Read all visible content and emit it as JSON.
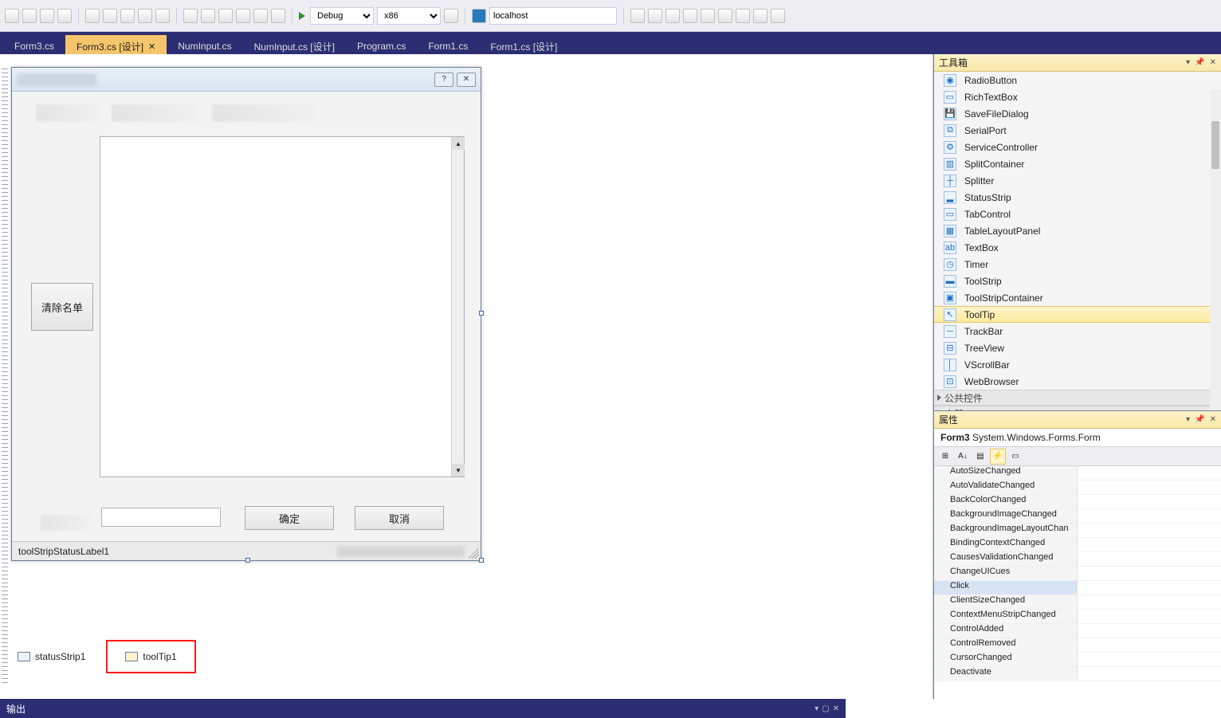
{
  "toolbar": {
    "config": "Debug",
    "platform": "x86",
    "target": "localhost"
  },
  "tabs": [
    {
      "label": "Form3.cs"
    },
    {
      "label": "Form3.cs [设计]",
      "active": true
    },
    {
      "label": "NumInput.cs"
    },
    {
      "label": "NumInput.cs [设计]"
    },
    {
      "label": "Program.cs"
    },
    {
      "label": "Form1.cs"
    },
    {
      "label": "Form1.cs [设计]"
    }
  ],
  "designer": {
    "clearButton": "清除名单",
    "okButton": "确定",
    "cancelButton": "取消",
    "statusLabel": "toolStripStatusLabel1"
  },
  "tray": {
    "statusStrip": "statusStrip1",
    "toolTip": "toolTip1"
  },
  "toolbox": {
    "title": "工具箱",
    "items": [
      {
        "name": "RadioButton",
        "icon": "◉"
      },
      {
        "name": "RichTextBox",
        "icon": "▭"
      },
      {
        "name": "SaveFileDialog",
        "icon": "💾"
      },
      {
        "name": "SerialPort",
        "icon": "⧉"
      },
      {
        "name": "ServiceController",
        "icon": "⚙"
      },
      {
        "name": "SplitContainer",
        "icon": "▥"
      },
      {
        "name": "Splitter",
        "icon": "┼"
      },
      {
        "name": "StatusStrip",
        "icon": "▂"
      },
      {
        "name": "TabControl",
        "icon": "▭"
      },
      {
        "name": "TableLayoutPanel",
        "icon": "▦"
      },
      {
        "name": "TextBox",
        "icon": "ab"
      },
      {
        "name": "Timer",
        "icon": "◷"
      },
      {
        "name": "ToolStrip",
        "icon": "▬"
      },
      {
        "name": "ToolStripContainer",
        "icon": "▣"
      },
      {
        "name": "ToolTip",
        "icon": "↖",
        "selected": true
      },
      {
        "name": "TrackBar",
        "icon": "─"
      },
      {
        "name": "TreeView",
        "icon": "⊟"
      },
      {
        "name": "VScrollBar",
        "icon": "│"
      },
      {
        "name": "WebBrowser",
        "icon": "⊡"
      }
    ],
    "groups": [
      "公共控件",
      "容器"
    ]
  },
  "properties": {
    "title": "属性",
    "objectName": "Form3",
    "objectType": "System.Windows.Forms.Form",
    "events": [
      "AutoSizeChanged",
      "AutoValidateChanged",
      "BackColorChanged",
      "BackgroundImageChanged",
      "BackgroundImageLayoutChan",
      "BindingContextChanged",
      "CausesValidationChanged",
      "ChangeUICues",
      "Click",
      "ClientSizeChanged",
      "ContextMenuStripChanged",
      "ControlAdded",
      "ControlRemoved",
      "CursorChanged",
      "Deactivate"
    ],
    "selectedEvent": "Click"
  },
  "outputBar": "输出"
}
